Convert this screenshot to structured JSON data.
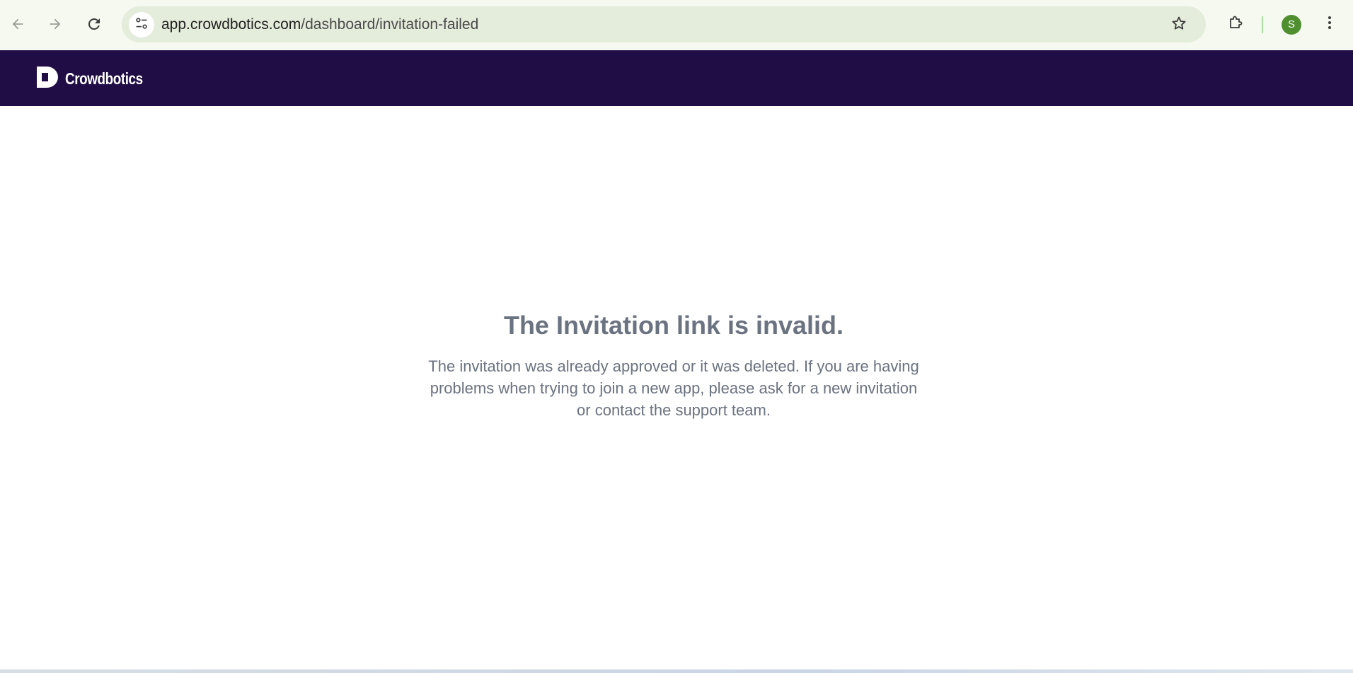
{
  "browser": {
    "url_host": "app.crowdbotics.com",
    "url_path": "/dashboard/invitation-failed",
    "profile_initial": "S",
    "icons": {
      "back": "arrow-left-icon",
      "forward": "arrow-right-icon",
      "reload": "reload-icon",
      "site_info": "tune-icon",
      "bookmark": "star-icon",
      "extensions": "puzzle-icon",
      "menu": "kebab-menu-icon"
    }
  },
  "header": {
    "brand_name": "Crowdbotics",
    "background_color": "#200d45"
  },
  "main": {
    "title": "The Invitation link is invalid.",
    "description": "The invitation was already approved or it was deleted. If you are having problems when trying to join a new app, please ask for a new invitation or contact the support team.",
    "text_color": "#6b7280"
  }
}
